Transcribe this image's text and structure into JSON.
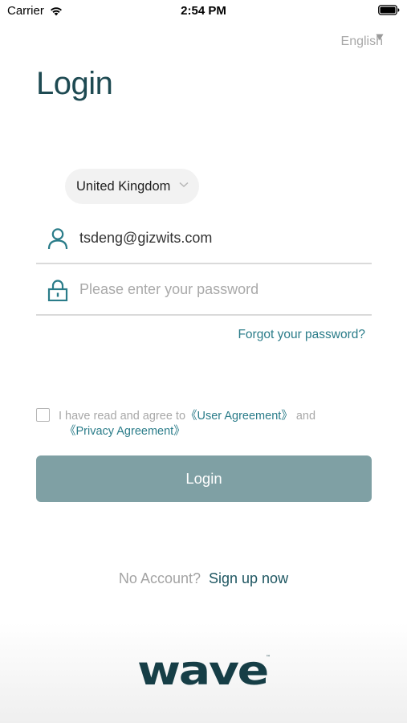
{
  "status_bar": {
    "carrier": "Carrier",
    "time": "2:54 PM"
  },
  "language": {
    "selected": "English"
  },
  "title": "Login",
  "region": {
    "selected": "United Kingdom"
  },
  "email": {
    "value": "tsdeng@gizwits.com"
  },
  "password": {
    "placeholder": "Please enter your password"
  },
  "forgot_label": "Forgot your password?",
  "agreement": {
    "prefix": "I have read and agree to",
    "user_agreement": "《User Agreement》",
    "and": "and",
    "privacy_agreement": "《Privacy Agreement》"
  },
  "login_button": "Login",
  "signup": {
    "prompt": "No Account?",
    "link": "Sign up now"
  },
  "logo_text": "wave",
  "colors": {
    "brand": "#1e4a52",
    "accent": "#2a7c89",
    "button": "#7fa0a4"
  }
}
